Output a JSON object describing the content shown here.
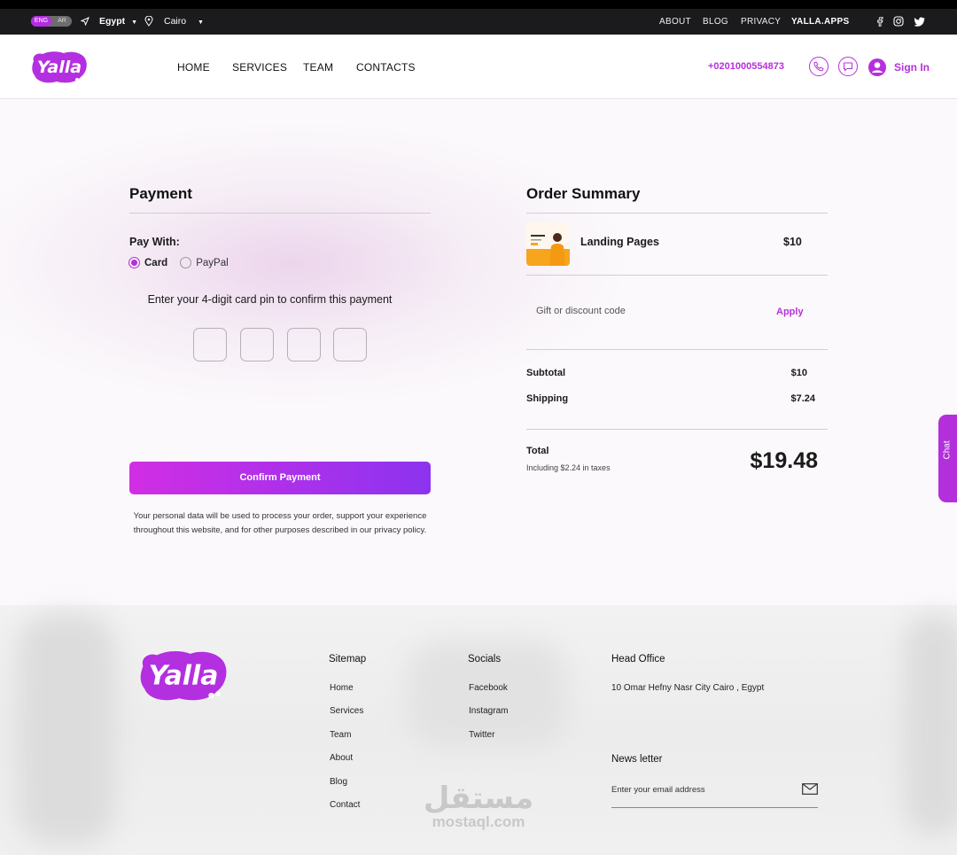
{
  "topbar": {
    "lang": {
      "eng": "ENG",
      "ar": "AR"
    },
    "country": "Egypt",
    "city": "Cairo",
    "links": [
      "ABOUT",
      "BLOG",
      "PRIVACY"
    ],
    "brand_link": "YALLA.APPS"
  },
  "header": {
    "logo_text": "Yalla",
    "nav": [
      "HOME",
      "SERVICES",
      "TEAM",
      "CONTACTS"
    ],
    "phone": "+0201000554873",
    "signin": "Sign In"
  },
  "payment": {
    "title": "Payment",
    "pay_with": "Pay With:",
    "options": [
      {
        "label": "Card",
        "selected": true
      },
      {
        "label": "PayPal",
        "selected": false
      }
    ],
    "pin_instruction": "Enter your 4-digit card pin to confirm this payment",
    "confirm_button": "Confirm Payment",
    "privacy_text": "Your personal data will be used to process your order, support your experience throughout this website, and for other purposes described in our privacy policy."
  },
  "order": {
    "title": "Order Summary",
    "item": {
      "name": "Landing Pages",
      "price": "$10"
    },
    "discount_placeholder": "Gift or discount code",
    "apply": "Apply",
    "subtotal_label": "Subtotal",
    "subtotal": "$10",
    "shipping_label": "Shipping",
    "shipping": "$7.24",
    "total_label": "Total",
    "taxes_note": "Including $2.24 in taxes",
    "total": "$19.48"
  },
  "chat_tab": "Chat",
  "footer": {
    "logo_text": "Yalla",
    "sitemap": {
      "title": "Sitemap",
      "links": [
        "Home",
        "Services",
        "Team",
        "About",
        "Blog",
        "Contact"
      ]
    },
    "socials": {
      "title": "Socials",
      "links": [
        "Facebook",
        "Instagram",
        "Twitter"
      ]
    },
    "head_office": {
      "title": "Head Office",
      "address": "10 Omar Hefny Nasr City Cairo , Egypt"
    },
    "newsletter": {
      "title": "News letter",
      "placeholder": "Enter your email address"
    },
    "watermark": {
      "ar": "مستقل",
      "en": "mostaql.com"
    }
  },
  "colors": {
    "accent": "#b530dc",
    "topbar": "#1b1b1d",
    "button_start": "#d12ee4",
    "button_end": "#8c33f0"
  }
}
